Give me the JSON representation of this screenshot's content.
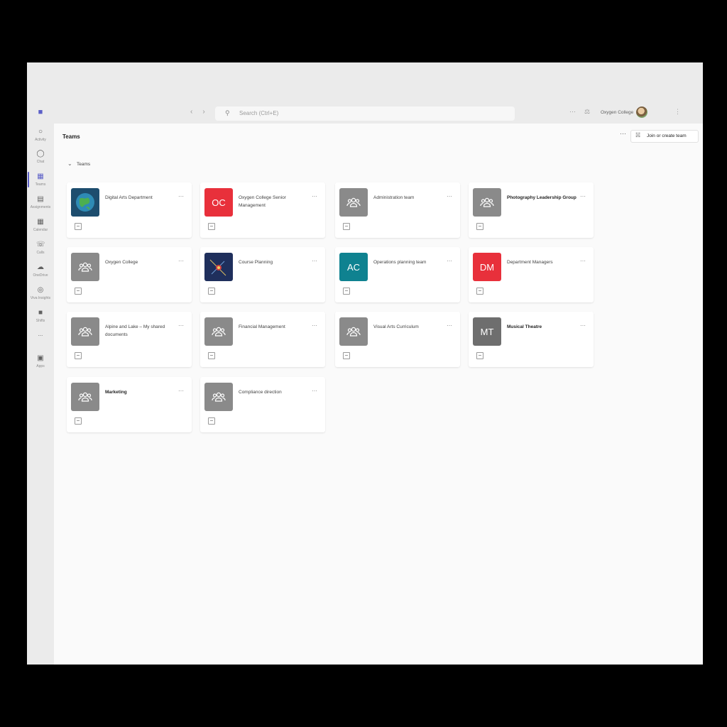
{
  "topbar": {
    "search_placeholder": "Search (Ctrl+E)",
    "user_name": "Oxygen College",
    "nav_icons": [
      "back-arrow-icon",
      "forward-arrow-icon"
    ],
    "more_icon": "ellipsis-icon"
  },
  "rail": {
    "items": [
      {
        "label": "Activity",
        "icon": "bell-icon"
      },
      {
        "label": "Chat",
        "icon": "chat-icon"
      },
      {
        "label": "Teams",
        "icon": "teams-icon",
        "active": true
      },
      {
        "label": "Assignments",
        "icon": "assignments-icon"
      },
      {
        "label": "Calendar",
        "icon": "calendar-icon"
      },
      {
        "label": "Calls",
        "icon": "phone-icon"
      },
      {
        "label": "OneDrive",
        "icon": "cloud-icon"
      },
      {
        "label": "Viva Insights",
        "icon": "insights-icon"
      },
      {
        "label": "Shifts",
        "icon": "shifts-icon"
      },
      {
        "label": "...",
        "icon": "more-apps-icon"
      },
      {
        "label": "Apps",
        "icon": "apps-icon"
      }
    ]
  },
  "header": {
    "title": "Teams",
    "join_label": "Join or create team"
  },
  "section": {
    "label": "Teams"
  },
  "teams": [
    {
      "name": "Digital Arts Department",
      "avatar": "globe-image"
    },
    {
      "name": "Oxygen College Senior Management",
      "avatar": "initials",
      "initials": "OC",
      "color": "#e8303b"
    },
    {
      "name": "Administration team",
      "avatar": "group-icon"
    },
    {
      "name": "Photography Leadership Group",
      "avatar": "group-icon",
      "bold": true
    },
    {
      "name": "Oxygen College",
      "avatar": "group-icon"
    },
    {
      "name": "Course Planning",
      "avatar": "navy-image"
    },
    {
      "name": "Operations planning team",
      "avatar": "initials",
      "initials": "AC",
      "color": "#0f8290"
    },
    {
      "name": "Department Managers",
      "avatar": "initials",
      "initials": "DM",
      "color": "#e8303b"
    },
    {
      "name": "Alpine and Lake – My shared documents",
      "avatar": "group-icon"
    },
    {
      "name": "Financial Management",
      "avatar": "group-icon"
    },
    {
      "name": "Visual Arts Curriculum",
      "avatar": "group-icon"
    },
    {
      "name": "Musical Theatre",
      "avatar": "initials",
      "initials": "MT",
      "color": "#6e6e6e",
      "bold": true
    },
    {
      "name": "Marketing",
      "avatar": "group-icon",
      "bold": true
    },
    {
      "name": "Compliance direction",
      "avatar": "group-icon"
    }
  ]
}
